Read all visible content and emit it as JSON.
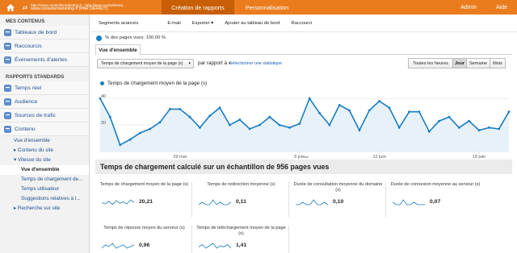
{
  "topbar": {
    "account_line1": "http://www.conseilsmarketing.fr - http://www.conseilsmar...",
    "account_line2": "www.conseilsmarketing.fr [PAR DÉFAUT]",
    "tabs": [
      {
        "label": "Création de rapports"
      },
      {
        "label": "Personnalisation"
      }
    ],
    "right": [
      {
        "label": "Admin"
      },
      {
        "label": "Aide"
      }
    ],
    "accent_color": "#ea7c1e",
    "active_color": "#c85f07"
  },
  "sidebar": {
    "mes_contenus": "MES CONTENUS",
    "top_items": [
      {
        "label": "Tableaux de bord",
        "icon": "dashboard-icon"
      },
      {
        "label": "Raccourcis",
        "icon": "shortcuts-icon"
      },
      {
        "label": "Événements d'alertes",
        "icon": "alert-icon"
      }
    ],
    "rapports_standards": "RAPPORTS STANDARDS",
    "report_items": [
      {
        "label": "Temps réel",
        "icon": "realtime-icon"
      },
      {
        "label": "Audience",
        "icon": "audience-icon"
      },
      {
        "label": "Sources de trafic",
        "icon": "traffic-sources-icon"
      },
      {
        "label": "Contenu",
        "icon": "content-icon"
      }
    ],
    "content_sub": [
      {
        "label": "Vue d'ensemble",
        "level": 1,
        "active": false
      },
      {
        "label": "▸ Contenu du site",
        "level": 1,
        "active": false
      },
      {
        "label": "▾ Vitesse du site",
        "level": 1,
        "active": false
      },
      {
        "label": "Vue d'ensemble",
        "level": 2,
        "active": true
      },
      {
        "label": "Temps de chargement de...",
        "level": 2,
        "active": false
      },
      {
        "label": "Temps utilisateur",
        "level": 2,
        "active": false
      },
      {
        "label": "Suggestions relatives à l...",
        "level": 2,
        "active": false
      },
      {
        "label": "▸ Recherche sur site",
        "level": 1,
        "active": false
      }
    ]
  },
  "toolbar": {
    "segments": "Segments avancés",
    "email": "E-mail",
    "export": "Exporter ▾",
    "add_dashboard": "Ajouter au tableau de bord",
    "shortcut": "Raccourci"
  },
  "pct_line": "% des pages vues: 100,00 %",
  "tab_overview": "Vue d'ensemble",
  "controls": {
    "metric_select": "Temps de chargement moyen de la page (s)",
    "par_rapport": "par rapport à",
    "select_stat": "Sélectionner une statistique",
    "granularity": [
      {
        "label": "Toutes les heures",
        "selected": false
      },
      {
        "label": "Jour",
        "selected": true
      },
      {
        "label": "Semaine",
        "selected": false
      },
      {
        "label": "Mois",
        "selected": false
      }
    ]
  },
  "chart_data": {
    "type": "area",
    "series": [
      {
        "name": "Temps de chargement moyen de la page (s)",
        "values": [
          40,
          26,
          5,
          9,
          14,
          17,
          22,
          32,
          32,
          26,
          18,
          27,
          33,
          20,
          24,
          17,
          20,
          26,
          20,
          18,
          21,
          40,
          29,
          20,
          35,
          31,
          16,
          31,
          38,
          33,
          18,
          30,
          30,
          15,
          23,
          26,
          18,
          23,
          16,
          18,
          17,
          30
        ]
      }
    ],
    "x_tick_labels": [
      "29 mai",
      "5 juin",
      "12 juin",
      "19 juin"
    ],
    "x_tick_indices": [
      8,
      20,
      28,
      38
    ],
    "y_tick_labels": [
      "40",
      "20"
    ],
    "ylim": [
      0,
      45
    ],
    "grid": true,
    "line_color": "#1a7dc0",
    "fill_color": "#e6f1f9"
  },
  "summary_title": "Temps de chargement calculé sur un échantillon de 956 pages vues",
  "cards": [
    {
      "label": "Temps de chargement moyen de la page (s)",
      "value": "20,21",
      "spark": [
        12,
        10,
        14,
        9,
        15,
        11,
        13,
        10,
        16,
        12
      ]
    },
    {
      "label": "Temps de redirection moyenne (s)",
      "value": "0,11",
      "spark": [
        10,
        11,
        10,
        10,
        12,
        10,
        11,
        10,
        10,
        11
      ]
    },
    {
      "label": "Durée de consultation moyenne du domaine (s)",
      "value": "0,10",
      "spark": [
        10,
        10,
        11,
        10,
        10,
        12,
        10,
        10,
        11,
        10
      ]
    },
    {
      "label": "Durée de connexion moyenne au serveur (s)",
      "value": "0,07",
      "spark": [
        11,
        10,
        10,
        12,
        10,
        10,
        11,
        10,
        10,
        10
      ]
    },
    {
      "label": "Temps de réponse moyen du serveur (s)",
      "value": "0,96",
      "spark": [
        10,
        12,
        11,
        13,
        10,
        11,
        12,
        10,
        11,
        12
      ]
    },
    {
      "label": "Temps de téléchargement moyen de la page (s)",
      "value": "1,41",
      "spark": [
        11,
        13,
        10,
        12,
        14,
        10,
        12,
        11,
        13,
        10
      ]
    }
  ]
}
